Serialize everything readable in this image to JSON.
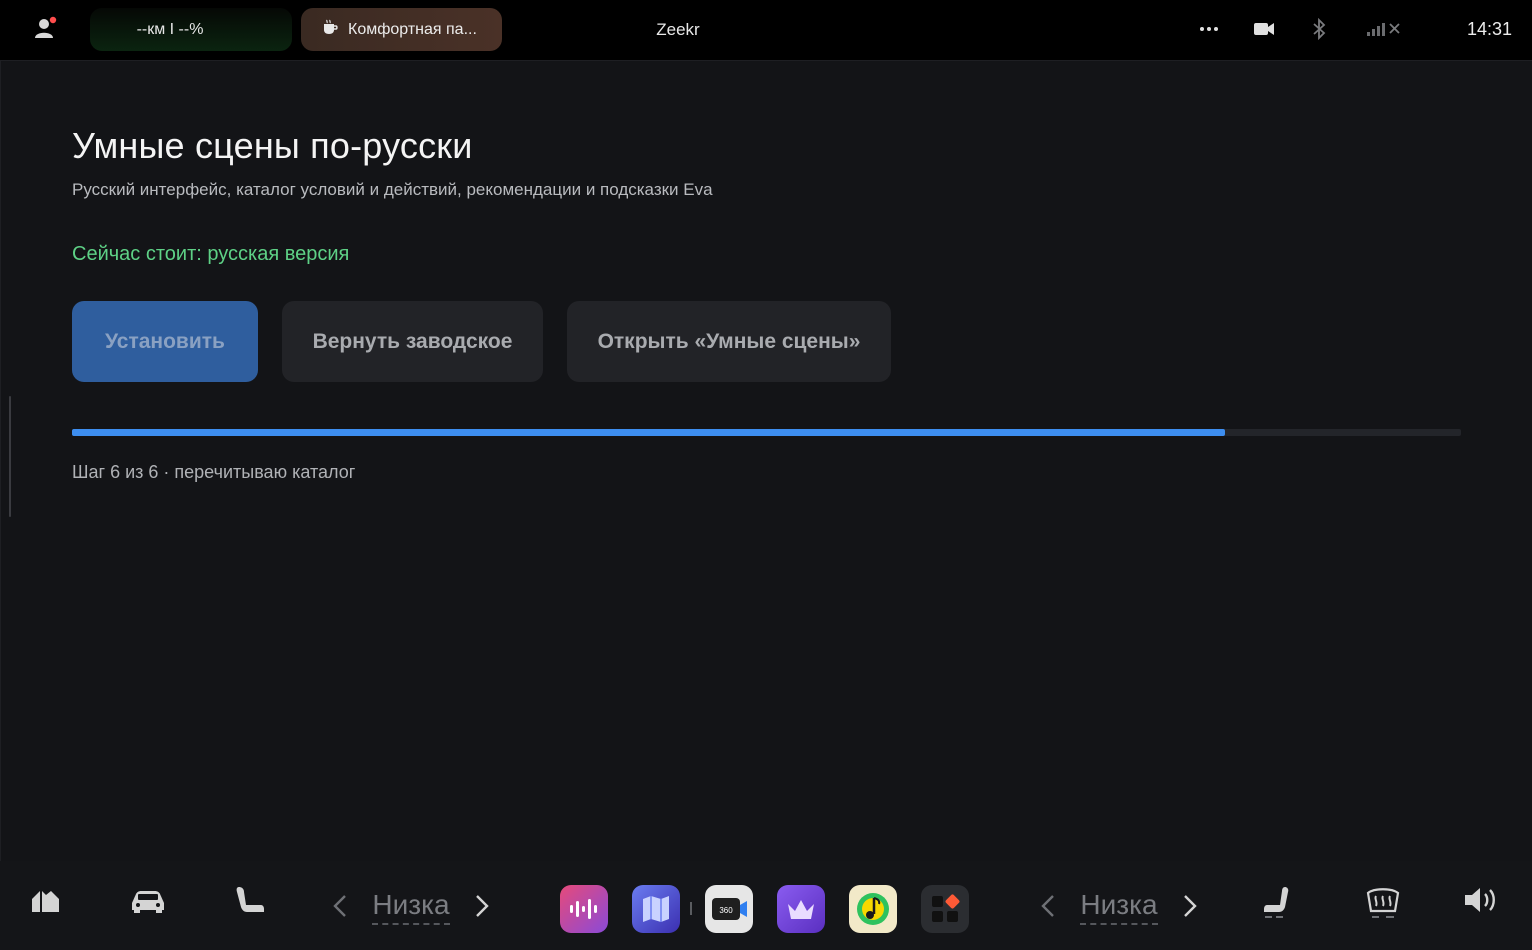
{
  "statusbar": {
    "range_text": "--км I --%",
    "mode_label": "Комфортная па...",
    "title": "Zeekr",
    "time": "14:31",
    "icons": [
      "profile-icon",
      "coffee-cup-icon",
      "more-icon",
      "camera-icon",
      "bluetooth-icon",
      "signal-off-icon"
    ]
  },
  "page": {
    "title": "Умные сцены по-русски",
    "subtitle": "Русский интерфейс, каталог условий и действий, рекомендации и подсказки Eva",
    "status": "Сейчас стоит: русская версия",
    "status_color": "#5ed186",
    "accent_color": "#3d8ef0"
  },
  "buttons": {
    "install": "Установить",
    "reset": "Вернуть заводское",
    "open": "Открыть «Умные сцены»"
  },
  "progress": {
    "percent": 83,
    "step_text": "Шаг 6 из 6 · перечитываю каталог"
  },
  "dock": {
    "left_temp": "Низка",
    "right_temp": "Низка",
    "left_icons": [
      "home-icon",
      "car-icon",
      "seat-icon"
    ],
    "apps": [
      "voice-app-icon",
      "maps-app-icon",
      "camera-360-app-icon",
      "crown-app-icon",
      "music-app-icon",
      "apps-grid-icon"
    ],
    "right_icons": [
      "seat-heat-icon",
      "rear-defrost-icon",
      "volume-icon"
    ]
  }
}
